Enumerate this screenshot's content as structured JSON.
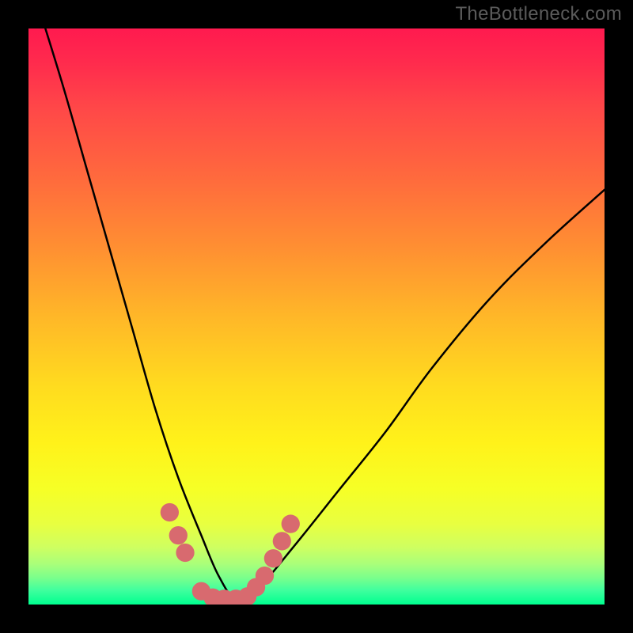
{
  "watermark": "TheBottleneck.com",
  "chart_data": {
    "type": "line",
    "title": "",
    "xlabel": "",
    "ylabel": "",
    "xlim": [
      0,
      100
    ],
    "ylim": [
      0,
      100
    ],
    "gradient_colors": {
      "top": "#ff1a4f",
      "mid_orange": "#ff8f32",
      "mid_yellow": "#fff21a",
      "bottom": "#00ff8f"
    },
    "series": [
      {
        "name": "bottleneck-curve",
        "color": "#000000",
        "x": [
          2,
          6,
          10,
          14,
          18,
          22,
          26,
          30,
          33,
          36,
          40,
          46,
          54,
          62,
          70,
          80,
          90,
          100
        ],
        "y_norm": [
          103,
          90,
          76,
          62,
          48,
          34,
          22,
          12,
          5,
          1,
          3,
          10,
          20,
          30,
          41,
          53,
          63,
          72
        ]
      }
    ],
    "markers": {
      "name": "highlight-dots",
      "color": "#d86a6f",
      "radius_norm": 1.6,
      "points": [
        {
          "x": 24.5,
          "y": 16
        },
        {
          "x": 26.0,
          "y": 12
        },
        {
          "x": 27.2,
          "y": 9
        },
        {
          "x": 30.0,
          "y": 2.3
        },
        {
          "x": 32.0,
          "y": 1.2
        },
        {
          "x": 34.0,
          "y": 1.0
        },
        {
          "x": 36.0,
          "y": 1.0
        },
        {
          "x": 38.0,
          "y": 1.4
        },
        {
          "x": 39.5,
          "y": 3.0
        },
        {
          "x": 41.0,
          "y": 5.0
        },
        {
          "x": 42.5,
          "y": 8.0
        },
        {
          "x": 44.0,
          "y": 11.0
        },
        {
          "x": 45.5,
          "y": 14.0
        }
      ]
    }
  }
}
